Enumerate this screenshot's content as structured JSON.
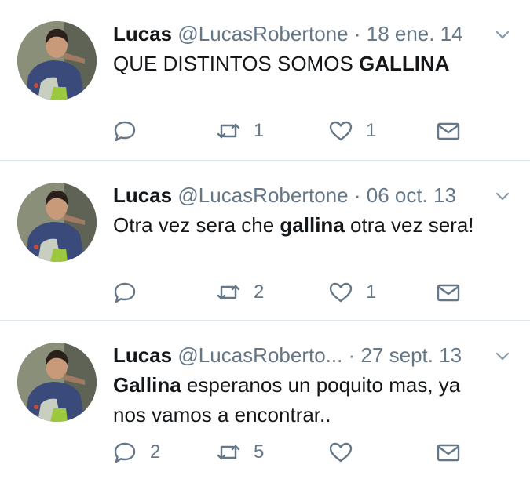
{
  "tweets": [
    {
      "name": "Lucas",
      "handle": "@LucasRobertone",
      "separator": "·",
      "date": "18 ene. 14",
      "text": [
        {
          "t": "QUE DISTINTOS SOMOS ",
          "bold": false
        },
        {
          "t": "GALLINA",
          "bold": true
        }
      ],
      "replies": "",
      "retweets": "1",
      "likes": "1"
    },
    {
      "name": "Lucas",
      "handle": "@LucasRobertone",
      "separator": "·",
      "date": "06 oct. 13",
      "text": [
        {
          "t": "Otra vez sera che ",
          "bold": false
        },
        {
          "t": "gallina",
          "bold": true
        },
        {
          "t": " otra vez sera!",
          "bold": false
        }
      ],
      "replies": "",
      "retweets": "2",
      "likes": "1"
    },
    {
      "name": "Lucas",
      "handle": "@LucasRoberto...",
      "separator": "·",
      "date": "27 sept. 13",
      "text": [
        {
          "t": "Gallina",
          "bold": true
        },
        {
          "t": " esperanos un poquito mas, ya nos vamos a encontrar..",
          "bold": false
        }
      ],
      "replies": "2",
      "retweets": "5",
      "likes": ""
    }
  ],
  "icons": {
    "avatar": "avatar",
    "caret": "chevron-down-icon",
    "reply": "reply-icon",
    "retweet": "retweet-icon",
    "like": "heart-icon",
    "dm": "envelope-icon"
  },
  "colors": {
    "text": "#14171a",
    "muted": "#657786",
    "divider": "#e1e8ed"
  }
}
